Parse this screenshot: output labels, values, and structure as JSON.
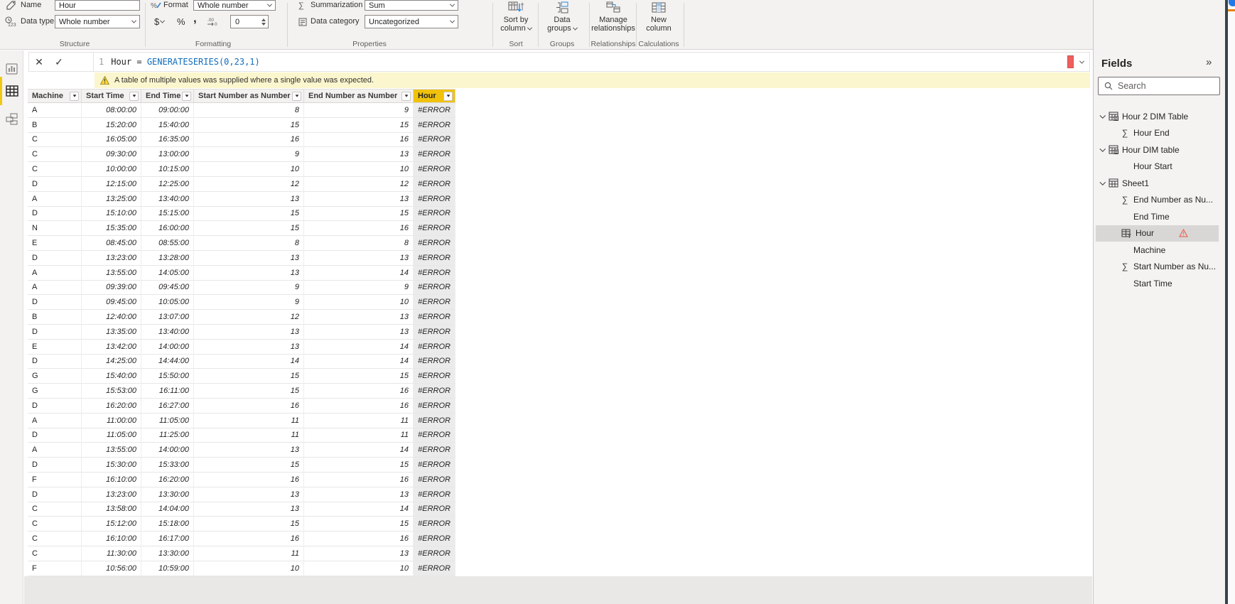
{
  "colors": {
    "accent_yellow": "#f2c80f",
    "warning_bg": "#fbf6cd",
    "selected_column_header": "#f0c20c",
    "error_indicator_red": "#ef5f5f",
    "field_warning_orange": "#e8705f",
    "dax_function_blue": "#0f6cbd"
  },
  "ribbon": {
    "structure": {
      "name_label": "Name",
      "name_value": "Hour",
      "datatype_label": "Data type",
      "datatype_value": "Whole number",
      "group_label": "Structure"
    },
    "formatting": {
      "format_label": "Format",
      "format_value": "Whole number",
      "currency_label": "$",
      "percent_label": "%",
      "thousands_label": ",",
      "decimals_value": "0",
      "group_label": "Formatting"
    },
    "properties": {
      "summarization_label": "Summarization",
      "summarization_value": "Sum",
      "category_label": "Data category",
      "category_value": "Uncategorized",
      "group_label": "Properties"
    },
    "sort": {
      "button_line1": "Sort by",
      "button_line2": "column",
      "group_label": "Sort"
    },
    "groups": {
      "button_line1": "Data",
      "button_line2": "groups",
      "group_label": "Groups"
    },
    "relationships": {
      "button_line1": "Manage",
      "button_line2": "relationships",
      "group_label": "Relationships"
    },
    "calculations": {
      "button_line1": "New",
      "button_line2": "column",
      "group_label": "Calculations"
    }
  },
  "formula_bar": {
    "line_number": "1",
    "expression_lhs": "Hour = ",
    "expression_fn": "GENERATESERIES(0,23,1)"
  },
  "warning": {
    "text": "A table of multiple values was supplied where a single value was expected."
  },
  "table": {
    "columns": [
      "Machine",
      "Start Time",
      "End Time",
      "Start Number as Number",
      "End Number as Number",
      "Hour"
    ],
    "selected_column": "Hour",
    "rows": [
      [
        "A",
        "08:00:00",
        "09:00:00",
        "8",
        "9",
        "#ERROR"
      ],
      [
        "B",
        "15:20:00",
        "15:40:00",
        "15",
        "15",
        "#ERROR"
      ],
      [
        "C",
        "16:05:00",
        "16:35:00",
        "16",
        "16",
        "#ERROR"
      ],
      [
        "C",
        "09:30:00",
        "13:00:00",
        "9",
        "13",
        "#ERROR"
      ],
      [
        "C",
        "10:00:00",
        "10:15:00",
        "10",
        "10",
        "#ERROR"
      ],
      [
        "D",
        "12:15:00",
        "12:25:00",
        "12",
        "12",
        "#ERROR"
      ],
      [
        "A",
        "13:25:00",
        "13:40:00",
        "13",
        "13",
        "#ERROR"
      ],
      [
        "D",
        "15:10:00",
        "15:15:00",
        "15",
        "15",
        "#ERROR"
      ],
      [
        "N",
        "15:35:00",
        "16:00:00",
        "15",
        "16",
        "#ERROR"
      ],
      [
        "E",
        "08:45:00",
        "08:55:00",
        "8",
        "8",
        "#ERROR"
      ],
      [
        "D",
        "13:23:00",
        "13:28:00",
        "13",
        "13",
        "#ERROR"
      ],
      [
        "A",
        "13:55:00",
        "14:05:00",
        "13",
        "14",
        "#ERROR"
      ],
      [
        "A",
        "09:39:00",
        "09:45:00",
        "9",
        "9",
        "#ERROR"
      ],
      [
        "D",
        "09:45:00",
        "10:05:00",
        "9",
        "10",
        "#ERROR"
      ],
      [
        "B",
        "12:40:00",
        "13:07:00",
        "12",
        "13",
        "#ERROR"
      ],
      [
        "D",
        "13:35:00",
        "13:40:00",
        "13",
        "13",
        "#ERROR"
      ],
      [
        "E",
        "13:42:00",
        "14:00:00",
        "13",
        "14",
        "#ERROR"
      ],
      [
        "D",
        "14:25:00",
        "14:44:00",
        "14",
        "14",
        "#ERROR"
      ],
      [
        "G",
        "15:40:00",
        "15:50:00",
        "15",
        "15",
        "#ERROR"
      ],
      [
        "G",
        "15:53:00",
        "16:11:00",
        "15",
        "16",
        "#ERROR"
      ],
      [
        "D",
        "16:20:00",
        "16:27:00",
        "16",
        "16",
        "#ERROR"
      ],
      [
        "A",
        "11:00:00",
        "11:05:00",
        "11",
        "11",
        "#ERROR"
      ],
      [
        "D",
        "11:05:00",
        "11:25:00",
        "11",
        "11",
        "#ERROR"
      ],
      [
        "A",
        "13:55:00",
        "14:00:00",
        "13",
        "14",
        "#ERROR"
      ],
      [
        "D",
        "15:30:00",
        "15:33:00",
        "15",
        "15",
        "#ERROR"
      ],
      [
        "F",
        "16:10:00",
        "16:20:00",
        "16",
        "16",
        "#ERROR"
      ],
      [
        "D",
        "13:23:00",
        "13:30:00",
        "13",
        "13",
        "#ERROR"
      ],
      [
        "C",
        "13:58:00",
        "14:04:00",
        "13",
        "14",
        "#ERROR"
      ],
      [
        "C",
        "15:12:00",
        "15:18:00",
        "15",
        "15",
        "#ERROR"
      ],
      [
        "C",
        "16:10:00",
        "16:17:00",
        "16",
        "16",
        "#ERROR"
      ],
      [
        "C",
        "11:30:00",
        "13:30:00",
        "11",
        "13",
        "#ERROR"
      ],
      [
        "F",
        "10:56:00",
        "10:59:00",
        "10",
        "10",
        "#ERROR"
      ]
    ]
  },
  "fields_pane": {
    "title": "Fields",
    "search_placeholder": "Search",
    "items": [
      {
        "label": "Hour 2 DIM Table",
        "type": "table-calc",
        "expanded": true
      },
      {
        "label": "Hour End",
        "type": "sigma"
      },
      {
        "label": "Hour DIM table",
        "type": "table-calc",
        "expanded": true
      },
      {
        "label": "Hour Start",
        "type": "plain"
      },
      {
        "label": "Sheet1",
        "type": "table",
        "expanded": true
      },
      {
        "label": "End Number as Nu...",
        "type": "sigma"
      },
      {
        "label": "End Time",
        "type": "plain"
      },
      {
        "label": "Hour",
        "type": "calc-column",
        "selected": true,
        "warning": true
      },
      {
        "label": "Machine",
        "type": "plain"
      },
      {
        "label": "Start Number as Nu...",
        "type": "sigma"
      },
      {
        "label": "Start Time",
        "type": "plain"
      }
    ]
  }
}
